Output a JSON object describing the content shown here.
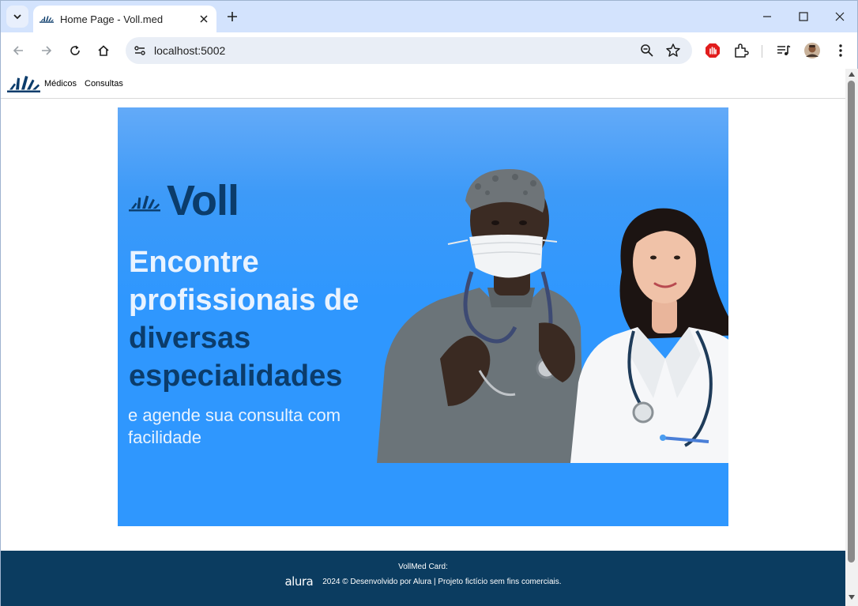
{
  "browser": {
    "tab_title": "Home Page - Voll.med",
    "url": "localhost:5002"
  },
  "nav": {
    "links": [
      "Médicos",
      "Consultas"
    ]
  },
  "hero": {
    "brand": "Voll",
    "headline_light": [
      "Encontre",
      "profissionais de"
    ],
    "headline_dark": [
      "diversas",
      "especialidades"
    ],
    "subtitle": "e agende sua consulta com facilidade"
  },
  "footer": {
    "title": "VollMed Card:",
    "alura_logo": "alura",
    "text": "2024 © Desenvolvido por Alura | Projeto fictício sem fins comerciais."
  },
  "colors": {
    "chrome_bg": "#d3e3fd",
    "brand_navy": "#0b3c6b",
    "hero_blue": "#2f97fe",
    "footer_bg": "#0b3c60"
  },
  "icons": [
    "tab-search-icon",
    "favicon-icon",
    "close-icon",
    "plus-icon",
    "minimize-icon",
    "maximize-icon",
    "window-close-icon",
    "back-icon",
    "forward-icon",
    "reload-icon",
    "home-icon",
    "site-info-icon",
    "zoom-icon",
    "star-icon",
    "adblock-icon",
    "extensions-icon",
    "media-icon",
    "profile-avatar",
    "menu-icon"
  ]
}
